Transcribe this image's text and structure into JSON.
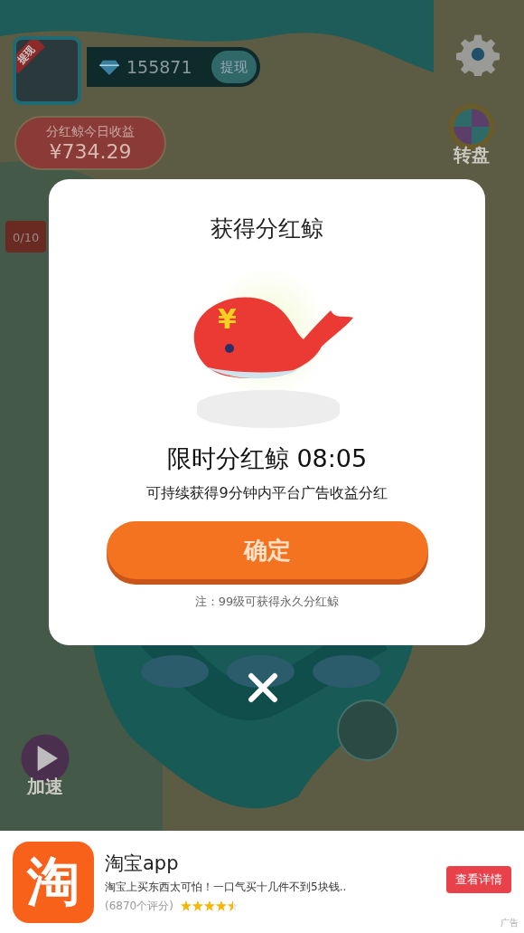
{
  "top_bar": {
    "avatar_badge": "提现",
    "diamonds": "155871",
    "withdraw_button": "提现"
  },
  "earnings": {
    "label": "分红鲸今日收益",
    "amount": "¥734.29"
  },
  "side_buttons": [
    {
      "kind": "wheel",
      "label": "转盘"
    },
    {
      "kind": "speed",
      "label": "加速"
    }
  ],
  "sign": "0/10",
  "dialog": {
    "title": "获得分红鲸",
    "whale_mark": "¥",
    "timer_label": "限时分红鲸 08:05",
    "description": "可持续获得9分钟内平台广告收益分红",
    "confirm_button": "确定",
    "note": "注：99级可获得永久分红鲸"
  },
  "ad": {
    "icon_text": "淘",
    "app_name": "淘宝app",
    "description": "淘宝上买东西太可怕！一口气买十几件不到5块钱..",
    "rating_count": "(6870个评分)",
    "stars": 4.5,
    "button": "查看详情",
    "ad_label": "广告"
  }
}
